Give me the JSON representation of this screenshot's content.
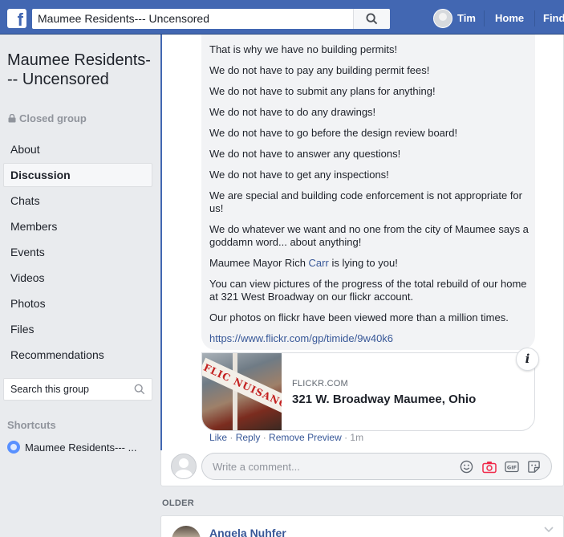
{
  "topbar": {
    "search_value": "Maumee Residents--- Uncensored",
    "user_name": "Tim",
    "nav": [
      "Home",
      "Find"
    ]
  },
  "group": {
    "title": "Maumee Residents--- Uncensored",
    "privacy": "Closed group"
  },
  "sidebar": {
    "items": [
      {
        "label": "About",
        "active": false
      },
      {
        "label": "Discussion",
        "active": true
      },
      {
        "label": "Chats",
        "active": false
      },
      {
        "label": "Members",
        "active": false
      },
      {
        "label": "Events",
        "active": false
      },
      {
        "label": "Videos",
        "active": false
      },
      {
        "label": "Photos",
        "active": false
      },
      {
        "label": "Files",
        "active": false
      },
      {
        "label": "Recommendations",
        "active": false
      }
    ],
    "search_placeholder": "Search this group",
    "shortcuts_heading": "Shortcuts",
    "shortcut_item": "Maumee Residents--- ..."
  },
  "comment": {
    "lines": [
      "That is why we have no building permits!",
      "We do not have to pay any building permit fees!",
      "We do not have to submit any plans for anything!",
      "We do not have to do any drawings!",
      "We do not have to go before the design review board!",
      "We do not have to answer any questions!",
      "We do not have to get any inspections!",
      "We are special and building code enforcement is not appropriate for us!",
      "We do whatever we want and no one from the city of Maumee says a goddamn word... about anything!"
    ],
    "mayor_prefix": "Maumee Mayor Rich ",
    "mayor_mention": "Carr",
    "mayor_suffix": " is lying to you!",
    "lines_after": [
      "You can view pictures of the progress of the total rebuild of our home at 321 West Broadway on our flickr account.",
      "Our photos on flickr have been viewed more than a million times."
    ],
    "link": "https://www.flickr.com/gp/timide/9w40k6",
    "preview": {
      "domain": "FLICKR.COM",
      "title": "321 W. Broadway Maumee, Ohio",
      "image_text": "FLIC NUISANC"
    },
    "actions": {
      "like": "Like",
      "reply": "Reply",
      "remove_preview": "Remove Preview",
      "time": "1m",
      "separator": " · "
    }
  },
  "composer": {
    "placeholder": "Write a comment..."
  },
  "older_label": "OLDER",
  "next_post": {
    "author": "Angela Nuhfer"
  },
  "colors": {
    "brand": "#4267b2",
    "link": "#385898",
    "bubble": "#f2f3f5"
  }
}
